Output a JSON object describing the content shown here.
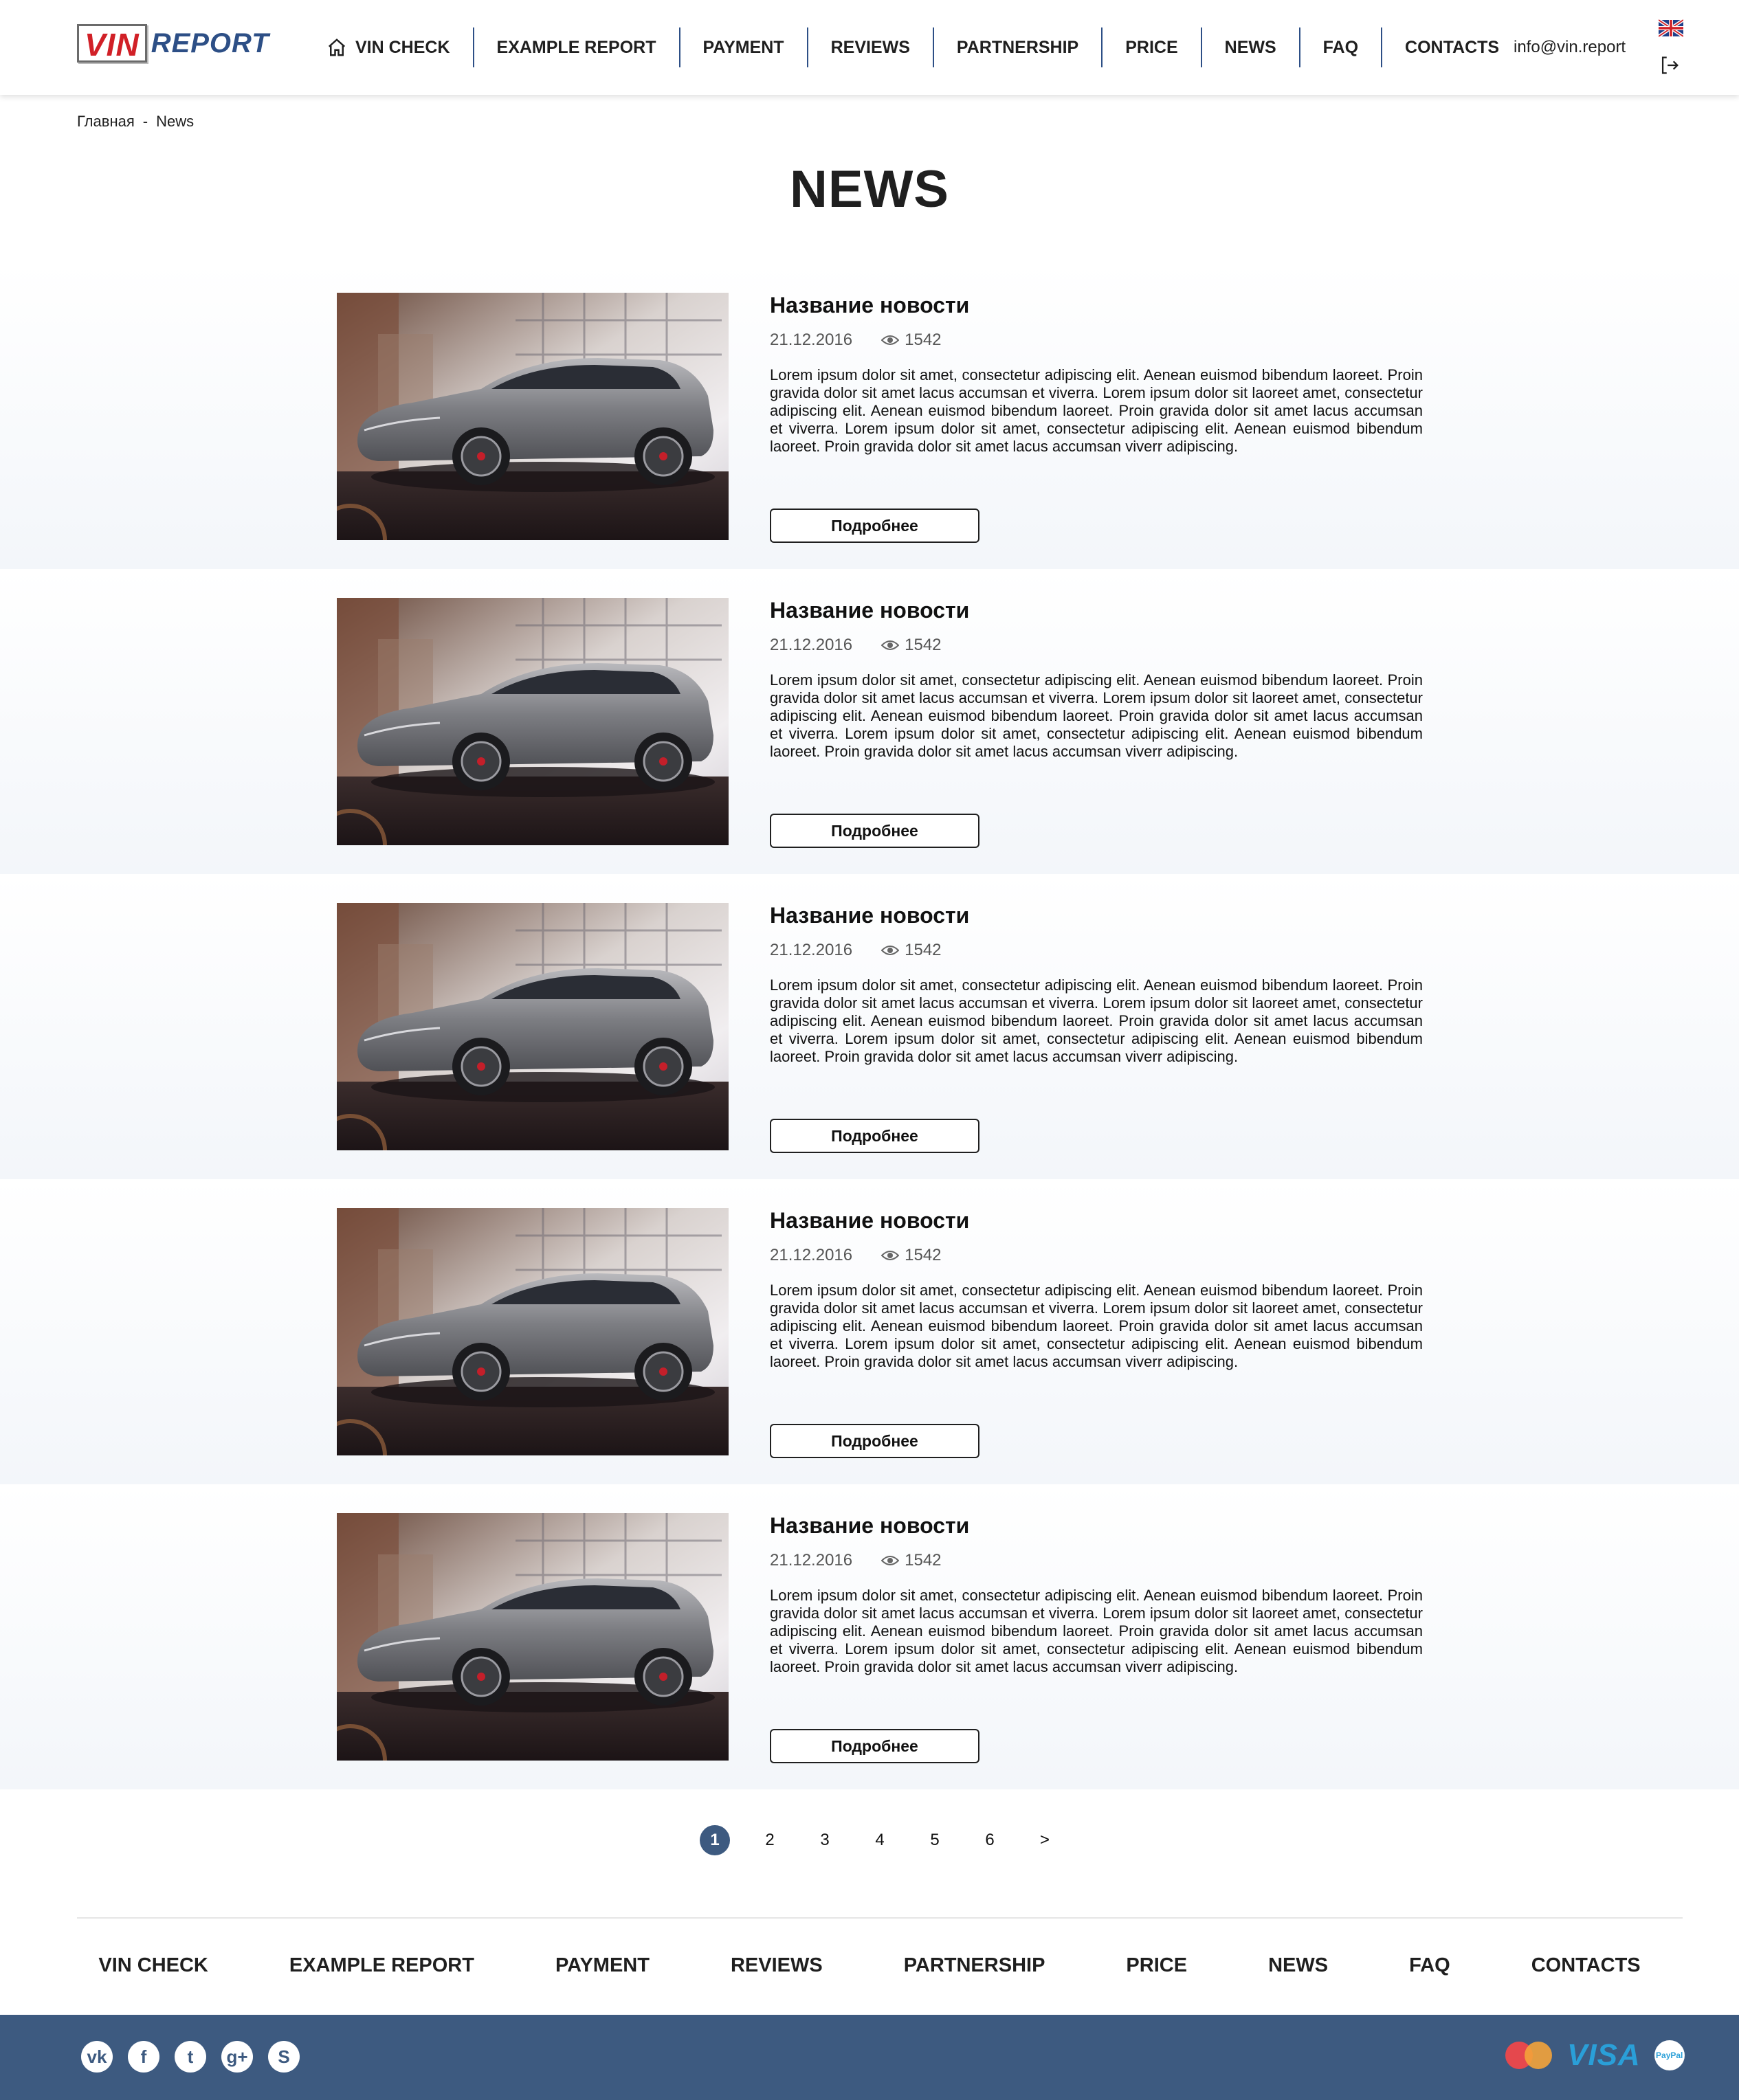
{
  "header": {
    "logo_vin": "VIN",
    "logo_report": "REPORT",
    "nav": [
      {
        "label": "VIN CHECK",
        "icon": "home-icon"
      },
      {
        "label": "EXAMPLE REPORT"
      },
      {
        "label": "PAYMENT"
      },
      {
        "label": "REVIEWS"
      },
      {
        "label": "PARTNERSHIP"
      },
      {
        "label": "PRICE"
      },
      {
        "label": "NEWS"
      },
      {
        "label": "FAQ"
      },
      {
        "label": "CONTACTS"
      }
    ],
    "email": "info@vin.report",
    "language_icon": "uk-flag-icon",
    "logout_icon": "logout-icon"
  },
  "breadcrumb": {
    "home": "Главная",
    "separator": "-",
    "current": "News"
  },
  "page_title": "NEWS",
  "news": [
    {
      "title": "Название новости",
      "date": "21.12.2016",
      "views": "1542",
      "text": "Lorem ipsum dolor sit amet, consectetur adipiscing elit. Aenean euismod bibendum laoreet. Proin gravida dolor sit amet lacus accumsan et viverra. Lorem ipsum dolor sit laoreet amet, consectetur adipiscing elit. Aenean euismod bibendum laoreet. Proin gravida dolor sit amet lacus accumsan et viverra. Lorem ipsum dolor sit amet, consectetur adipiscing elit. Aenean euismod bibendum laoreet. Proin gravida dolor sit amet lacus accumsan viverr adipiscing.",
      "button": "Подробнее"
    },
    {
      "title": "Название новости",
      "date": "21.12.2016",
      "views": "1542",
      "text": "Lorem ipsum dolor sit amet, consectetur adipiscing elit. Aenean euismod bibendum laoreet. Proin gravida dolor sit amet lacus accumsan et viverra. Lorem ipsum dolor sit laoreet amet, consectetur adipiscing elit. Aenean euismod bibendum laoreet. Proin gravida dolor sit amet lacus accumsan et viverra. Lorem ipsum dolor sit amet, consectetur adipiscing elit. Aenean euismod bibendum laoreet. Proin gravida dolor sit amet lacus accumsan viverr adipiscing.",
      "button": "Подробнее"
    },
    {
      "title": "Название новости",
      "date": "21.12.2016",
      "views": "1542",
      "text": "Lorem ipsum dolor sit amet, consectetur adipiscing elit. Aenean euismod bibendum laoreet. Proin gravida dolor sit amet lacus accumsan et viverra. Lorem ipsum dolor sit laoreet amet, consectetur adipiscing elit. Aenean euismod bibendum laoreet. Proin gravida dolor sit amet lacus accumsan et viverra. Lorem ipsum dolor sit amet, consectetur adipiscing elit. Aenean euismod bibendum laoreet. Proin gravida dolor sit amet lacus accumsan viverr adipiscing.",
      "button": "Подробнее"
    },
    {
      "title": "Название новости",
      "date": "21.12.2016",
      "views": "1542",
      "text": "Lorem ipsum dolor sit amet, consectetur adipiscing elit. Aenean euismod bibendum laoreet. Proin gravida dolor sit amet lacus accumsan et viverra. Lorem ipsum dolor sit laoreet amet, consectetur adipiscing elit. Aenean euismod bibendum laoreet. Proin gravida dolor sit amet lacus accumsan et viverra. Lorem ipsum dolor sit amet, consectetur adipiscing elit. Aenean euismod bibendum laoreet. Proin gravida dolor sit amet lacus accumsan viverr adipiscing.",
      "button": "Подробнее"
    },
    {
      "title": "Название новости",
      "date": "21.12.2016",
      "views": "1542",
      "text": "Lorem ipsum dolor sit amet, consectetur adipiscing elit. Aenean euismod bibendum laoreet. Proin gravida dolor sit amet lacus accumsan et viverra. Lorem ipsum dolor sit laoreet amet, consectetur adipiscing elit. Aenean euismod bibendum laoreet. Proin gravida dolor sit amet lacus accumsan et viverra. Lorem ipsum dolor sit amet, consectetur adipiscing elit. Aenean euismod bibendum laoreet. Proin gravida dolor sit amet lacus accumsan viverr adipiscing.",
      "button": "Подробнее"
    }
  ],
  "pagination": {
    "pages": [
      "1",
      "2",
      "3",
      "4",
      "5",
      "6"
    ],
    "next": ">",
    "current": "1"
  },
  "footer": {
    "nav": [
      "VIN CHECK",
      "EXAMPLE REPORT",
      "PAYMENT",
      "REVIEWS",
      "PARTNERSHIP",
      "PRICE",
      "NEWS",
      "FAQ",
      "CONTACTS"
    ],
    "social": [
      {
        "icon": "vk-icon",
        "glyph": "vk"
      },
      {
        "icon": "facebook-icon",
        "glyph": "f"
      },
      {
        "icon": "twitter-icon",
        "glyph": "t"
      },
      {
        "icon": "google-plus-icon",
        "glyph": "g+"
      },
      {
        "icon": "skype-icon",
        "glyph": "S"
      }
    ],
    "payments": [
      {
        "icon": "mastercard-icon"
      },
      {
        "icon": "visa-icon",
        "label": "VISA"
      },
      {
        "icon": "paypal-icon",
        "label": "PayPal"
      }
    ],
    "bar_color": "#3d5a80"
  },
  "colors": {
    "accent": "#2d4f86",
    "logo_red": "#d12027",
    "active_page": "#3d5a80"
  }
}
